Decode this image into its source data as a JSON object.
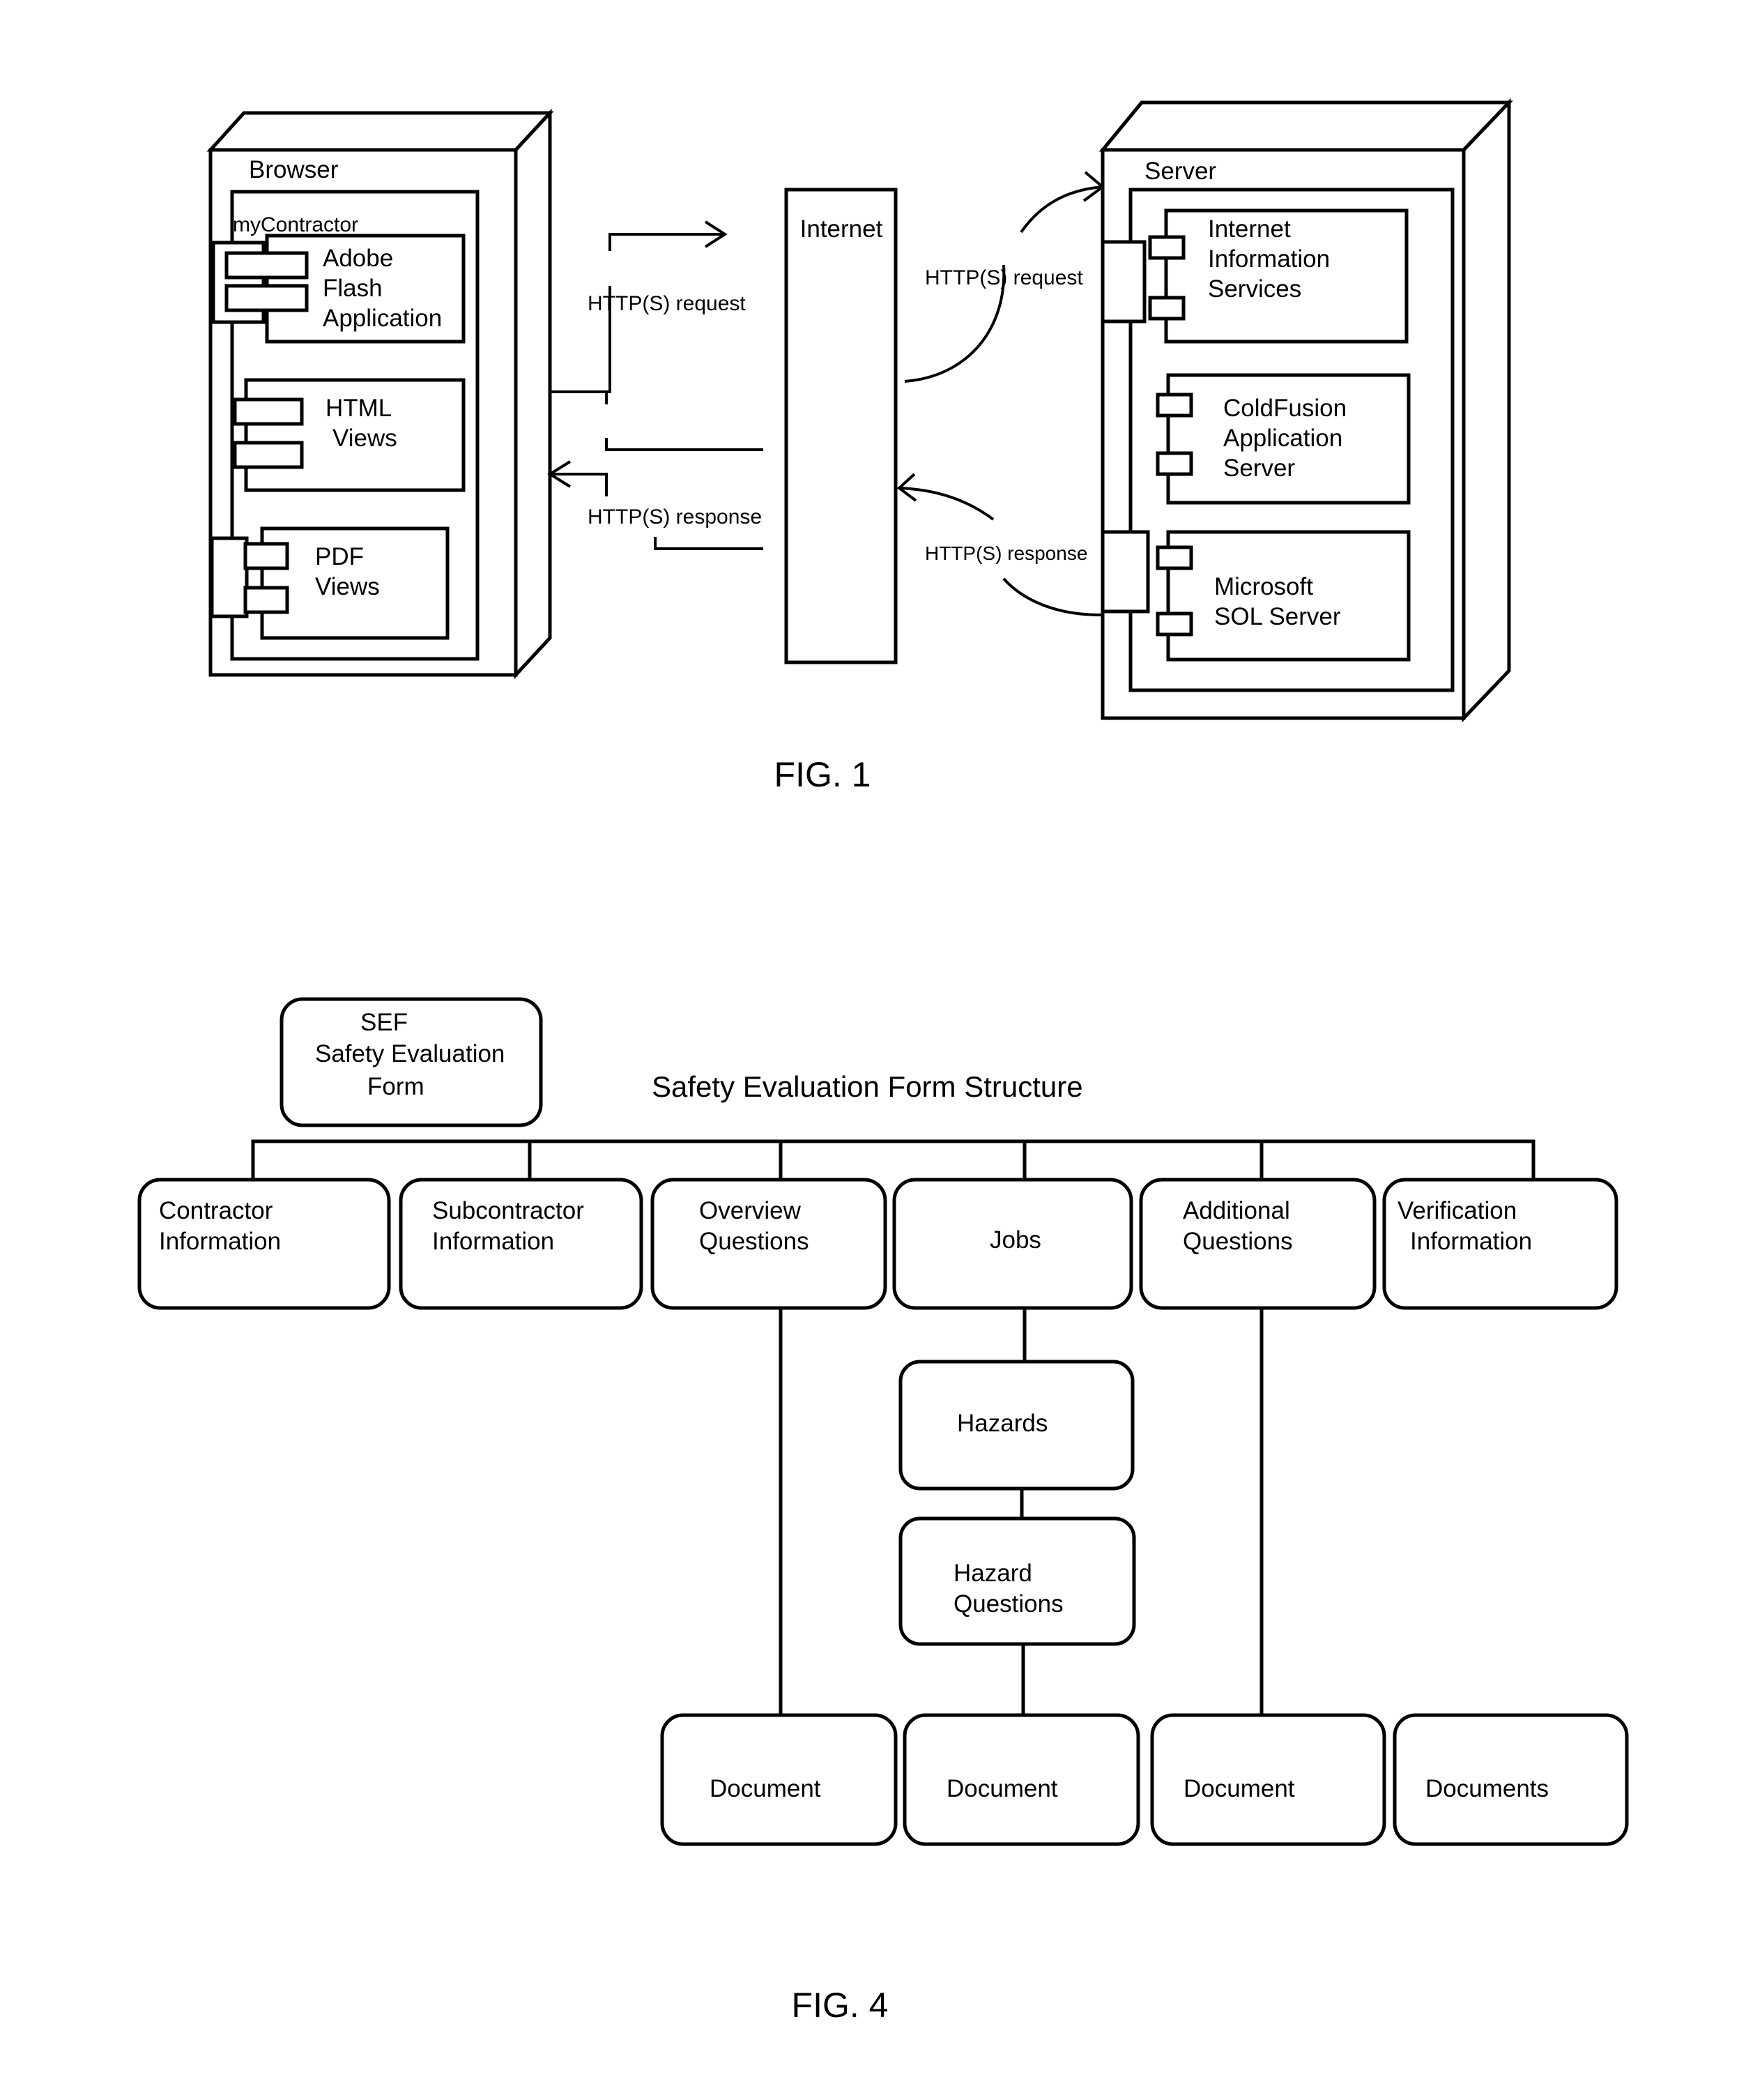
{
  "fig1": {
    "caption": "FIG. 1",
    "browser": {
      "title": "Browser",
      "package_label": "myContractor",
      "components": [
        {
          "lines": [
            "Adobe",
            "Flash",
            "Application"
          ]
        },
        {
          "lines": [
            "HTML",
            "Views"
          ]
        },
        {
          "lines": [
            "PDF",
            "Views"
          ]
        }
      ]
    },
    "internet": {
      "title": "Internet"
    },
    "server": {
      "title": "Server",
      "components": [
        {
          "lines": [
            "Internet",
            "Information",
            "Services"
          ]
        },
        {
          "lines": [
            "ColdFusion",
            "Application",
            "Server"
          ]
        },
        {
          "lines": [
            "Microsoft",
            "SOL Server"
          ]
        }
      ]
    },
    "connections": {
      "browser_request": "HTTP(S) request",
      "browser_response": "HTTP(S) response",
      "server_request": "HTTP(S) request",
      "server_response": "HTTP(S) response"
    }
  },
  "fig4": {
    "caption": "FIG. 4",
    "title": "Safety Evaluation Form Structure",
    "root": {
      "lines": [
        "SEF",
        "Safety Evaluation",
        "Form"
      ]
    },
    "sections": [
      {
        "lines": [
          "Contractor",
          "Information"
        ]
      },
      {
        "lines": [
          "Subcontractor",
          "Information"
        ]
      },
      {
        "lines": [
          "Overview",
          "Questions"
        ]
      },
      {
        "lines": [
          "Jobs"
        ]
      },
      {
        "lines": [
          "Additional",
          "Questions"
        ]
      },
      {
        "lines": [
          "Verification",
          "Information"
        ]
      }
    ],
    "hazards": {
      "lines": [
        "Hazards"
      ]
    },
    "hazard_questions": {
      "lines": [
        "Hazard",
        "Questions"
      ]
    },
    "documents": [
      {
        "label": "Document"
      },
      {
        "label": "Document"
      },
      {
        "label": "Document"
      },
      {
        "label": "Documents"
      }
    ]
  }
}
